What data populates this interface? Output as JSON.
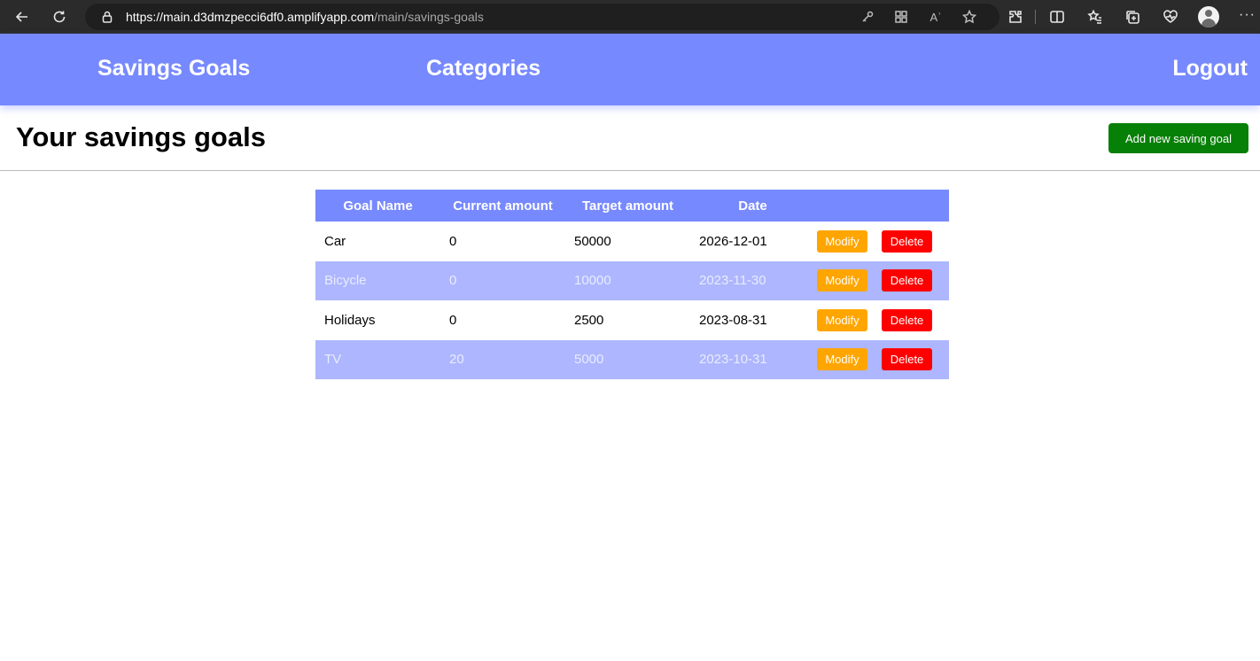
{
  "browser": {
    "url_host": "https://main.d3dmzpecci6df0.amplifyapp.com",
    "url_path": "/main/savings-goals",
    "icons": [
      "back-icon",
      "refresh-icon",
      "lock-icon",
      "key-icon",
      "apps-icon",
      "read-aloud-icon",
      "favorite-star-icon",
      "extensions-icon",
      "split-screen-icon",
      "favorites-icon",
      "collections-icon",
      "performance-icon",
      "profile-icon",
      "more-icon"
    ],
    "read_aloud_label": "Aʾ",
    "more_label": "···"
  },
  "nav": {
    "savings_goals": "Savings Goals",
    "categories": "Categories",
    "logout": "Logout"
  },
  "page": {
    "title": "Your savings goals",
    "add_button": "Add new saving goal"
  },
  "table": {
    "headers": [
      "Goal Name",
      "Current amount",
      "Target amount",
      "Date",
      ""
    ],
    "rows": [
      {
        "name": "Car",
        "current": "0",
        "target": "50000",
        "date": "2026-12-01",
        "modify": "Modify",
        "delete": "Delete"
      },
      {
        "name": "Bicycle",
        "current": "0",
        "target": "10000",
        "date": "2023-11-30",
        "modify": "Modify",
        "delete": "Delete"
      },
      {
        "name": "Holidays",
        "current": "0",
        "target": "2500",
        "date": "2023-08-31",
        "modify": "Modify",
        "delete": "Delete"
      },
      {
        "name": "TV",
        "current": "20",
        "target": "5000",
        "date": "2023-10-31",
        "modify": "Modify",
        "delete": "Delete"
      }
    ]
  },
  "colors": {
    "nav_bg": "#7789fe",
    "row_alt_bg": "#adb6fe",
    "add_button": "#078007",
    "modify_button": "#ffa500",
    "delete_button": "#ff0000",
    "browser_bg": "#2b2b2b"
  }
}
